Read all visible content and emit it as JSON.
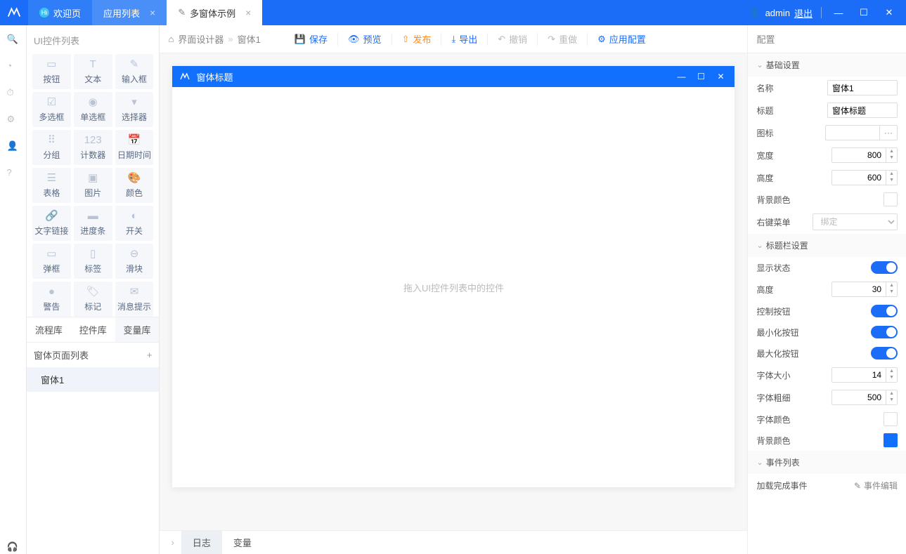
{
  "titlebar": {
    "tabs": [
      {
        "label": "欢迎页"
      },
      {
        "label": "应用列表"
      },
      {
        "label": "多窗体示例"
      }
    ],
    "user": "admin",
    "logout": "退出"
  },
  "leftpanel": {
    "title": "UI控件列表",
    "widgets": [
      {
        "label": "按钮",
        "icon": "▭"
      },
      {
        "label": "文本",
        "icon": "T"
      },
      {
        "label": "输入框",
        "icon": "✎"
      },
      {
        "label": "多选框",
        "icon": "☑"
      },
      {
        "label": "单选框",
        "icon": "◉"
      },
      {
        "label": "选择器",
        "icon": "▾"
      },
      {
        "label": "分组",
        "icon": "⠿"
      },
      {
        "label": "计数器",
        "icon": "123"
      },
      {
        "label": "日期时间",
        "icon": "📅"
      },
      {
        "label": "表格",
        "icon": "☰"
      },
      {
        "label": "图片",
        "icon": "▣"
      },
      {
        "label": "颜色",
        "icon": "🎨"
      },
      {
        "label": "文字链接",
        "icon": "🔗"
      },
      {
        "label": "进度条",
        "icon": "▬"
      },
      {
        "label": "开关",
        "icon": "◐"
      },
      {
        "label": "弹框",
        "icon": "▭"
      },
      {
        "label": "标签",
        "icon": "▯"
      },
      {
        "label": "滑块",
        "icon": "⊖"
      },
      {
        "label": "警告",
        "icon": "●"
      },
      {
        "label": "标记",
        "icon": "🏷"
      },
      {
        "label": "消息提示",
        "icon": "✉"
      }
    ],
    "libtabs": [
      "流程库",
      "控件库",
      "变量库"
    ],
    "formlist_title": "窗体页面列表",
    "form_items": [
      "窗体1"
    ]
  },
  "toolbar": {
    "crumb_root": "界面设计器",
    "crumb_leaf": "窗体1",
    "buttons": {
      "save": "保存",
      "preview": "预览",
      "publish": "发布",
      "export": "导出",
      "undo": "撤销",
      "redo": "重做",
      "config": "应用配置"
    }
  },
  "canvas": {
    "window_title": "窗体标题",
    "placeholder": "拖入UI控件列表中的控件"
  },
  "bottom_tabs": [
    "日志",
    "变量"
  ],
  "rightpanel": {
    "title": "配置",
    "sections": {
      "basic": "基础设置",
      "titlebar": "标题栏设置",
      "events": "事件列表"
    },
    "props": {
      "name_label": "名称",
      "name_value": "窗体1",
      "title_label": "标题",
      "title_value": "窗体标题",
      "icon_label": "图标",
      "width_label": "宽度",
      "width_value": "800",
      "height_label": "高度",
      "height_value": "600",
      "bgcolor_label": "背景颜色",
      "contextmenu_label": "右键菜单",
      "contextmenu_value": "绑定",
      "show_label": "显示状态",
      "tb_height_label": "高度",
      "tb_height_value": "30",
      "ctrl_btn_label": "控制按钮",
      "min_btn_label": "最小化按钮",
      "max_btn_label": "最大化按钮",
      "fontsize_label": "字体大小",
      "fontsize_value": "14",
      "fontweight_label": "字体粗细",
      "fontweight_value": "500",
      "fontcolor_label": "字体颜色",
      "tb_bgcolor_label": "背景颜色"
    },
    "event": {
      "load_label": "加载完成事件",
      "edit_label": "事件编辑"
    }
  }
}
